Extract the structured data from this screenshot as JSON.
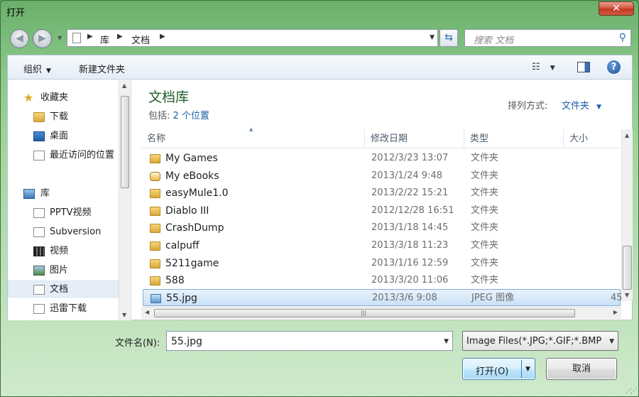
{
  "window": {
    "title": "打开",
    "close_glyph": "✕"
  },
  "address": {
    "crumbs": [
      "库",
      "文档"
    ],
    "search_placeholder": "搜索 文档"
  },
  "toolbar": {
    "organize": "组织",
    "new_folder": "新建文件夹"
  },
  "nav": {
    "items": [
      {
        "label": "收藏夹",
        "icon": "star-icon"
      },
      {
        "label": "下载",
        "icon": "downloads-folder-icon"
      },
      {
        "label": "桌面",
        "icon": "desktop-icon"
      },
      {
        "label": "最近访问的位置",
        "icon": "recent-places-icon"
      },
      {
        "label": "库",
        "icon": "library-icon"
      },
      {
        "label": "PPTV视频",
        "icon": "document-library-icon"
      },
      {
        "label": "Subversion",
        "icon": "document-library-icon"
      },
      {
        "label": "视频",
        "icon": "video-library-icon"
      },
      {
        "label": "图片",
        "icon": "picture-library-icon"
      },
      {
        "label": "文档",
        "icon": "document-library-icon",
        "selected": true
      },
      {
        "label": "迅雷下载",
        "icon": "document-library-icon"
      }
    ]
  },
  "library": {
    "title": "文档库",
    "includes_prefix": "包括:",
    "includes_link": "2 个位置",
    "arrange_label": "排列方式:",
    "arrange_value": "文件夹"
  },
  "columns": {
    "name": "名称",
    "modified": "修改日期",
    "type": "类型",
    "size": "大小"
  },
  "files": [
    {
      "name": "My Games",
      "modified": "2012/3/23 13:07",
      "type": "文件夹",
      "size": ""
    },
    {
      "name": "My eBooks",
      "modified": "2013/1/24 9:48",
      "type": "文件夹",
      "size": ""
    },
    {
      "name": "easyMule1.0",
      "modified": "2013/2/22 15:21",
      "type": "文件夹",
      "size": ""
    },
    {
      "name": "Diablo III",
      "modified": "2012/12/28 16:51",
      "type": "文件夹",
      "size": ""
    },
    {
      "name": "CrashDump",
      "modified": "2013/1/18 14:45",
      "type": "文件夹",
      "size": ""
    },
    {
      "name": "calpuff",
      "modified": "2013/3/18 11:23",
      "type": "文件夹",
      "size": ""
    },
    {
      "name": "5211game",
      "modified": "2013/1/16 12:59",
      "type": "文件夹",
      "size": ""
    },
    {
      "name": "588",
      "modified": "2013/3/20 11:06",
      "type": "文件夹",
      "size": ""
    },
    {
      "name": "55.jpg",
      "modified": "2013/3/6 9:08",
      "type": "JPEG 图像",
      "size": "45",
      "selected": true
    }
  ],
  "bottom": {
    "filename_label": "文件名(N):",
    "filename_value": "55.jpg",
    "filetype_value": "Image Files(*.JPG;*.GIF;*.BMP",
    "open_label": "打开(O)",
    "cancel_label": "取消"
  },
  "colors": {
    "selection": "#c9e0f7",
    "library_title": "#1e5c2a",
    "link": "#1a5ea8"
  }
}
